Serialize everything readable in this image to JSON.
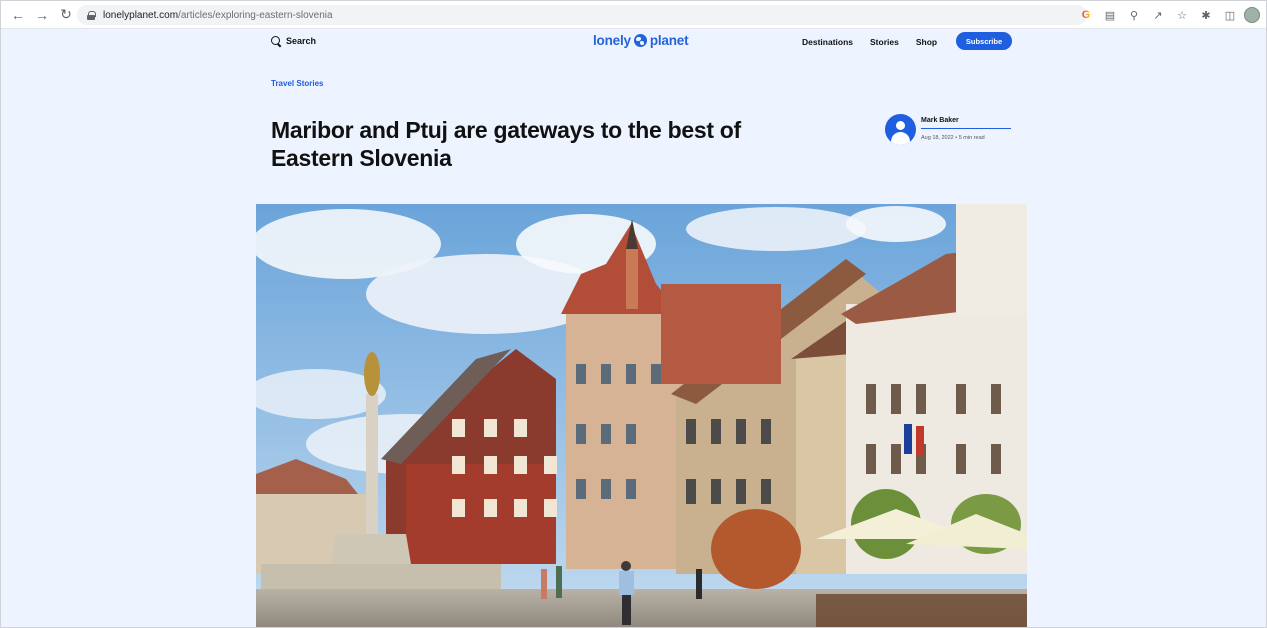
{
  "browser": {
    "url_host": "lonelyplanet.com",
    "url_path": "/articles/exploring-eastern-slovenia",
    "nav": {
      "back_icon": "arrow-left-icon",
      "forward_icon": "arrow-right-icon",
      "reload_icon": "reload-icon"
    }
  },
  "header": {
    "search_label": "Search",
    "logo_text_1": "lonely",
    "logo_text_2": "planet",
    "nav_items": [
      "Destinations",
      "Stories",
      "Shop"
    ],
    "subscribe_label": "Subscribe"
  },
  "article": {
    "category": "Travel Stories",
    "title": "Maribor and Ptuj are gateways to the best of Eastern Slovenia",
    "author_name": "Mark Baker",
    "meta": "Aug 18, 2022 • 5 min read"
  },
  "colors": {
    "brand_blue": "#1f5ede",
    "page_bg": "#eef4ff"
  }
}
